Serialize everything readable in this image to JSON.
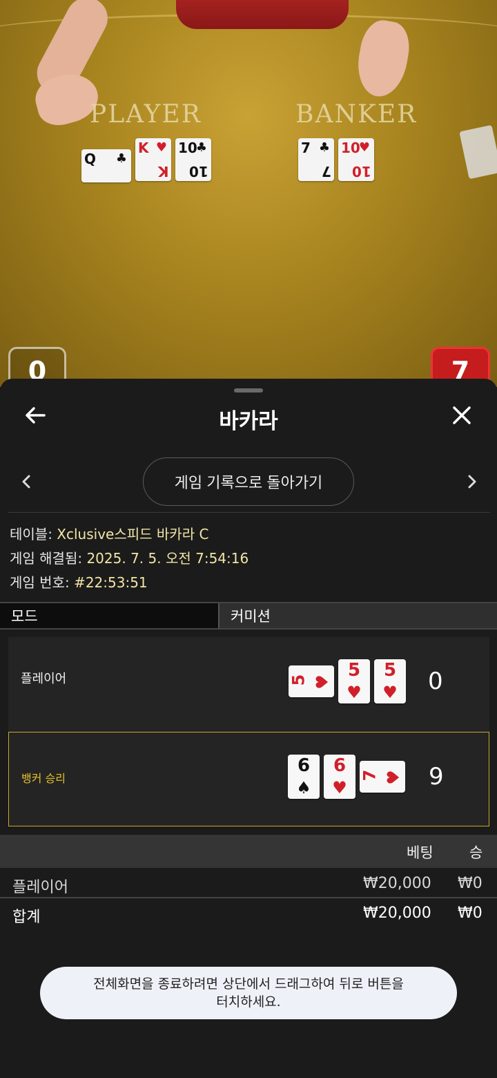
{
  "video": {
    "player_label": "PLAYER",
    "banker_label": "BANKER",
    "player_cards": [
      {
        "value": "Q",
        "suit": "♣",
        "color": "black",
        "rotated": true
      },
      {
        "value": "K",
        "suit": "♥",
        "color": "red",
        "rotated": false
      },
      {
        "value": "10",
        "suit": "♣",
        "color": "black",
        "rotated": false
      }
    ],
    "banker_cards": [
      {
        "value": "7",
        "suit": "♣",
        "color": "black",
        "rotated": false
      },
      {
        "value": "10",
        "suit": "♥",
        "color": "red",
        "rotated": false
      }
    ],
    "player_score_badge": "0",
    "banker_score_badge": "7"
  },
  "header": {
    "title": "바카라",
    "back_icon": "arrow-left-icon",
    "close_icon": "close-icon"
  },
  "nav": {
    "back_to_history": "게임 기록으로 돌아가기"
  },
  "info": {
    "table_label": "테이블: ",
    "table_value": "Xclusive스피드 바카라 C",
    "resolved_label": "게임 해결됨: ",
    "resolved_value": "2025. 7. 5. 오전 7:54:16",
    "number_label": "게임 번호: ",
    "number_value": "#22:53:51"
  },
  "tabs": {
    "mode": "모드",
    "commission": "커미션"
  },
  "results": {
    "player": {
      "label": "플레이어",
      "score": "0",
      "cards": [
        {
          "value": "5",
          "suit": "♥",
          "horizontal": true
        },
        {
          "value": "5",
          "suit": "♥",
          "horizontal": false
        },
        {
          "value": "5",
          "suit": "♥",
          "horizontal": false
        }
      ]
    },
    "banker": {
      "label": "뱅커 승리",
      "score": "9",
      "cards": [
        {
          "value": "6",
          "suit": "♠",
          "color": "black",
          "horizontal": false
        },
        {
          "value": "6",
          "suit": "♥",
          "color": "red",
          "horizontal": false
        },
        {
          "value": "7",
          "suit": "♥",
          "color": "red",
          "horizontal": true
        }
      ]
    }
  },
  "bets": {
    "col_bet": "베팅",
    "col_win": "승",
    "rows": [
      {
        "name": "플레이어",
        "bet": "₩20,000",
        "win": "₩0"
      }
    ],
    "total": {
      "name": "합계",
      "bet": "₩20,000",
      "win": "₩0"
    }
  },
  "toast": {
    "line1": "전체화면을 종료하려면 상단에서 드래그하여 뒤로 버튼을",
    "line2": "터치하세요."
  },
  "colors": {
    "accent_gold": "#e5c22b",
    "info_value": "#f2e6a6",
    "card_red": "#d11f2a",
    "banker_badge": "#c51d1d"
  }
}
